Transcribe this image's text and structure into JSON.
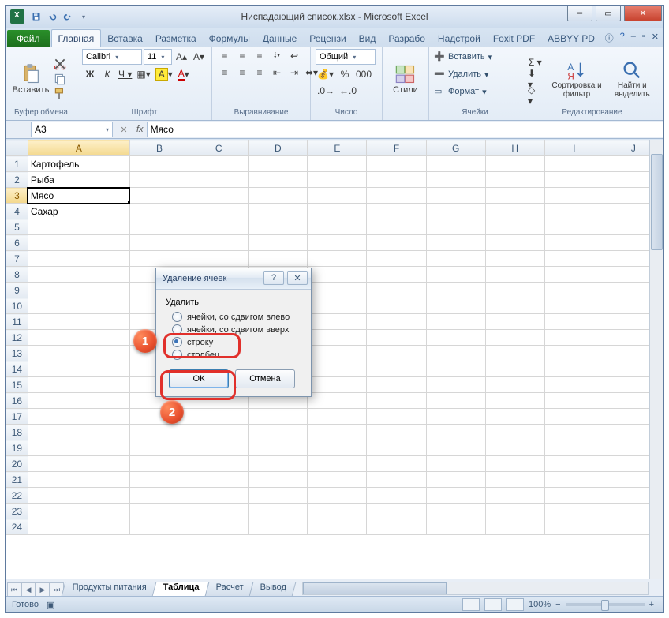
{
  "window": {
    "title": "Ниспадающий список.xlsx - Microsoft Excel"
  },
  "tabs": {
    "file": "Файл",
    "items": [
      "Главная",
      "Вставка",
      "Разметка",
      "Формулы",
      "Данные",
      "Рецензи",
      "Вид",
      "Разрабо",
      "Надстрой",
      "Foxit PDF",
      "ABBYY PD"
    ],
    "active_index": 0
  },
  "ribbon": {
    "clipboard": {
      "paste": "Вставить",
      "title": "Буфер обмена"
    },
    "font": {
      "name": "Calibri",
      "size": "11",
      "title": "Шрифт"
    },
    "alignment": {
      "title": "Выравнивание"
    },
    "number": {
      "format": "Общий",
      "title": "Число"
    },
    "styles": {
      "btn": "Стили"
    },
    "cells": {
      "insert": "Вставить",
      "delete": "Удалить",
      "format": "Формат",
      "title": "Ячейки"
    },
    "editing": {
      "sort": "Сортировка и фильтр",
      "find": "Найти и выделить",
      "title": "Редактирование"
    }
  },
  "formula_bar": {
    "namebox": "A3",
    "fx": "fx",
    "value": "Мясо"
  },
  "columns": [
    "A",
    "B",
    "C",
    "D",
    "E",
    "F",
    "G",
    "H",
    "I",
    "J"
  ],
  "rows_shown": 24,
  "data": {
    "A1": "Картофель",
    "A2": "Рыба",
    "A3": "Мясо",
    "A4": "Сахар"
  },
  "selected_cell": "A3",
  "dialog": {
    "title": "Удаление ячеек",
    "group": "Удалить",
    "options": [
      "ячейки, со сдвигом влево",
      "ячейки, со сдвигом вверх",
      "строку",
      "столбец"
    ],
    "selected_index": 2,
    "ok": "ОК",
    "cancel": "Отмена"
  },
  "sheet_tabs": {
    "items": [
      "Продукты питания",
      "Таблица",
      "Расчет",
      "Вывод"
    ],
    "active_index": 1
  },
  "statusbar": {
    "ready": "Готово",
    "zoom": "100%"
  },
  "annotations": {
    "b1": "1",
    "b2": "2"
  }
}
